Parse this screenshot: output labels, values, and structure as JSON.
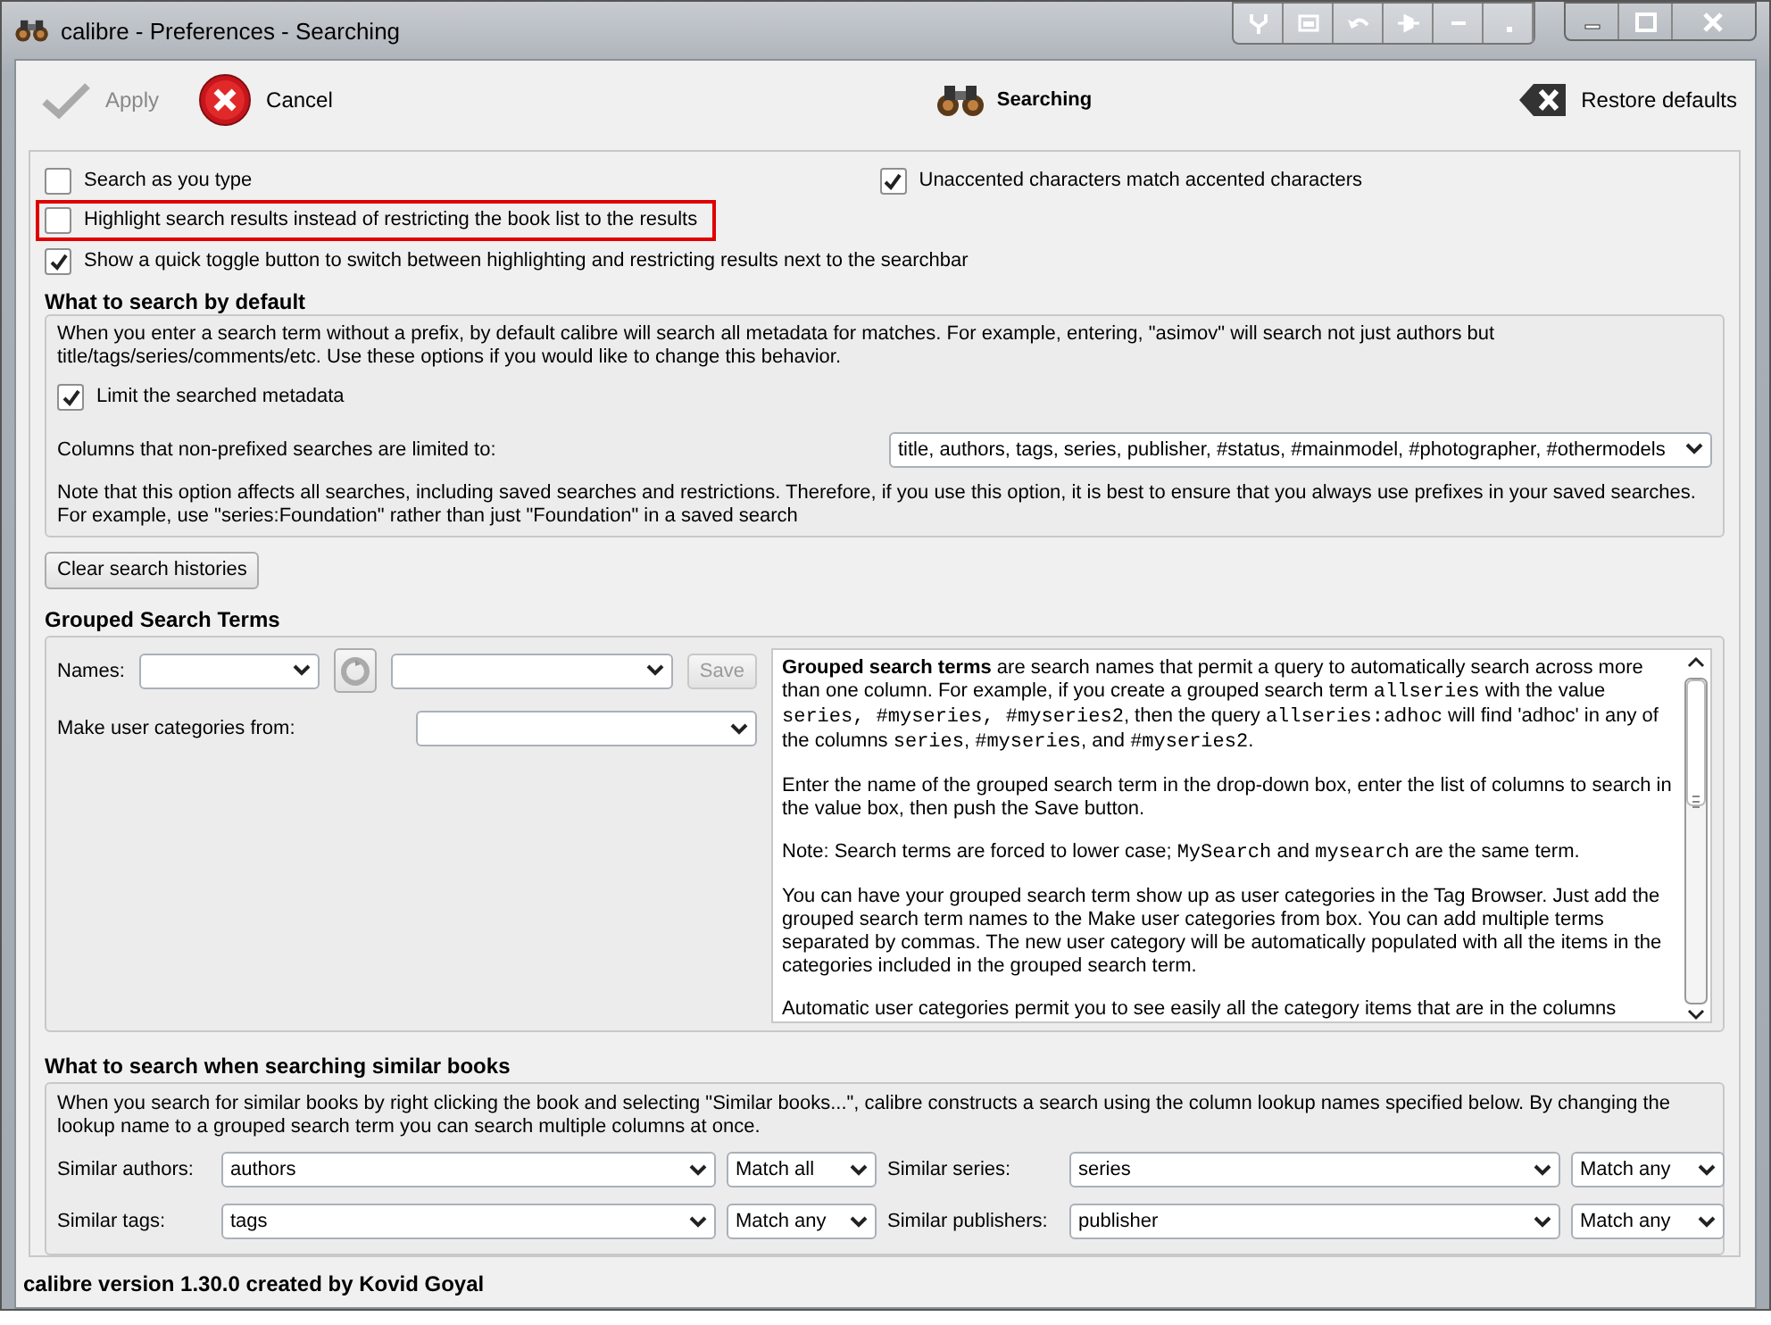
{
  "window": {
    "title": "calibre - Preferences - Searching"
  },
  "toolbar": {
    "apply": {
      "label": "Apply",
      "disabled": true
    },
    "cancel": {
      "label": "Cancel"
    },
    "heading": "Searching",
    "restore": {
      "label": "Restore defaults"
    }
  },
  "options_row": [
    {
      "label": "Search as you type",
      "checked": false
    },
    {
      "label": "Unaccented characters match accented characters",
      "checked": true
    }
  ],
  "options": [
    {
      "label": "Highlight search results instead of restricting the book list to the results",
      "checked": false,
      "highlighted": true
    },
    {
      "label": "Show a quick toggle button to switch between highlighting and restricting results next to the searchbar",
      "checked": true,
      "highlighted": false
    }
  ],
  "default_search": {
    "title": "What to search by default",
    "description": "When you enter a search term without a prefix, by default calibre will search all metadata for matches. For example, entering, \"asimov\" will search not just authors but title/tags/series/comments/etc. Use these options if you would like to change this behavior.",
    "limit": {
      "label": "Limit the searched metadata",
      "checked": true
    },
    "columns_label": "Columns that non-prefixed searches are limited to:",
    "columns_value": "title, authors, tags, series, publisher, #status, #mainmodel, #photographer, #othermodels",
    "note": "Note that this option affects all searches, including saved searches and restrictions. Therefore, if you use this option, it is best to ensure that you always use prefixes in your saved searches. For example, use \"series:Foundation\" rather than just \"Foundation\" in  a saved search"
  },
  "clear_button": "Clear search histories",
  "grouped": {
    "title": "Grouped Search Terms",
    "names_label": "Names:",
    "save_button": {
      "label": "Save",
      "disabled": true
    },
    "categories_label": "Make user categories from:",
    "help": [
      [
        {
          "kind": "bold",
          "text": "Grouped search terms"
        },
        {
          "kind": "text",
          "text": " are search names that permit a query to automatically search across more than one column. For example, if you create a grouped search term "
        },
        {
          "kind": "code",
          "text": "allseries"
        },
        {
          "kind": "text",
          "text": " with the value "
        },
        {
          "kind": "code",
          "text": "series, #myseries, #myseries2"
        },
        {
          "kind": "text",
          "text": ", then the query "
        },
        {
          "kind": "code",
          "text": "allseries:adhoc"
        },
        {
          "kind": "text",
          "text": " will find 'adhoc' in any of the columns "
        },
        {
          "kind": "code",
          "text": "series"
        },
        {
          "kind": "text",
          "text": ", "
        },
        {
          "kind": "code",
          "text": "#myseries"
        },
        {
          "kind": "text",
          "text": ", and "
        },
        {
          "kind": "code",
          "text": "#myseries2"
        },
        {
          "kind": "text",
          "text": "."
        }
      ],
      [
        {
          "kind": "text",
          "text": "Enter the name of the grouped search term in the drop-down box, enter the list of columns to search in the value box, then push the Save button."
        }
      ],
      [
        {
          "kind": "text",
          "text": "Note: Search terms are forced to lower case; "
        },
        {
          "kind": "code",
          "text": "MySearch"
        },
        {
          "kind": "text",
          "text": " and "
        },
        {
          "kind": "code",
          "text": "mysearch"
        },
        {
          "kind": "text",
          "text": " are the same term."
        }
      ],
      [
        {
          "kind": "text",
          "text": "You can have your grouped search term show up as user categories in the Tag Browser. Just add the grouped search term names to the Make user categories from box. You can add multiple terms separated by commas. The new user category will be automatically populated with all the items in the categories included in the grouped search term."
        }
      ],
      [
        {
          "kind": "text",
          "text": "Automatic user categories permit you to see easily all the category items that are in the columns"
        }
      ]
    ]
  },
  "similar": {
    "title": "What to search when searching similar books",
    "description": "When you search for similar books by right clicking the book and selecting \"Similar books...\", calibre constructs a search using the column lookup names specified below. By changing the lookup name to a grouped search term you can search multiple columns at once.",
    "rows": [
      {
        "label": "Similar authors:",
        "value": "authors",
        "match": "Match all"
      },
      {
        "label": "Similar series:",
        "value": "series",
        "match": "Match any"
      },
      {
        "label": "Similar tags:",
        "value": "tags",
        "match": "Match any"
      },
      {
        "label": "Similar publishers:",
        "value": "publisher",
        "match": "Match any"
      }
    ]
  },
  "footer": "calibre version 1.30.0 created by Kovid Goyal"
}
